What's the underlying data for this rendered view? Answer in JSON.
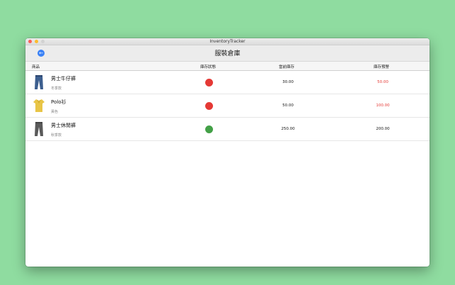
{
  "window": {
    "title": "InventoryTracker"
  },
  "nav": {
    "back_icon": "←",
    "title": "服裝倉庫"
  },
  "columns": {
    "product": "商品",
    "status": "庫存狀態",
    "current": "當前庫存",
    "warning": "庫存預警"
  },
  "colors": {
    "status_low": "#e53935",
    "status_ok": "#43a047",
    "warning_alert": "#e53935"
  },
  "rows": [
    {
      "name": "男士牛仔褲",
      "sub": "冬季款",
      "icon": "jeans-icon",
      "status": "low",
      "current": "30.00",
      "warning": "50.00",
      "warning_alert": true
    },
    {
      "name": "Polo衫",
      "sub": "黃色",
      "icon": "polo-shirt-icon",
      "status": "low",
      "current": "50.00",
      "warning": "100.00",
      "warning_alert": true
    },
    {
      "name": "男士休閒褲",
      "sub": "秋季款",
      "icon": "casual-pants-icon",
      "status": "ok",
      "current": "250.00",
      "warning": "200.00",
      "warning_alert": false
    }
  ]
}
